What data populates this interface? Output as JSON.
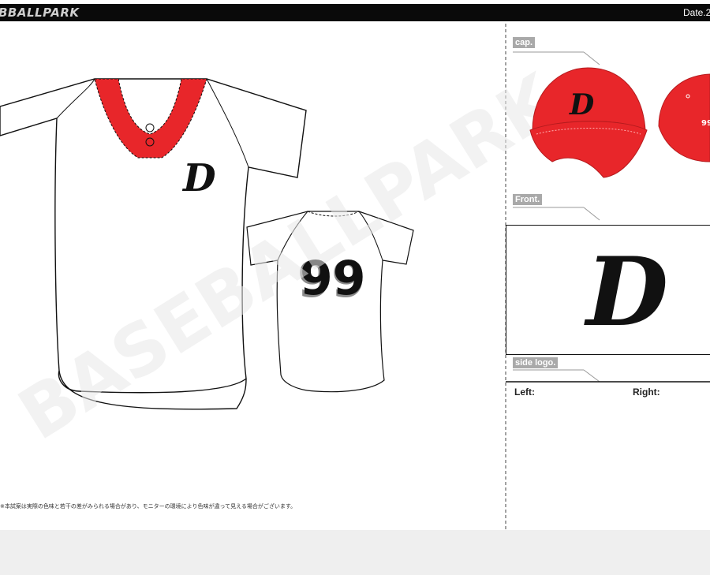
{
  "header": {
    "brand": "BBALLPARK",
    "date_label": "Date.2"
  },
  "watermark": "BASEBALLPARK",
  "jersey": {
    "front_logo": "D",
    "back_number": "99",
    "collar_color": "#e8262a",
    "body_color": "#ffffff"
  },
  "sections": {
    "cap": {
      "label": "cap.",
      "logo": "D",
      "number": "99",
      "cap_color": "#e8262a"
    },
    "front": {
      "label": "Front.",
      "logo": "D"
    },
    "side_logo": {
      "label": "side logo.",
      "left_label": "Left:",
      "right_label": "Right:"
    }
  },
  "footer": {
    "disclaimer": "※本試案は実際の色味と若干の差がみられる場合があり、モニターの環境により色味が違って見える場合がございます。"
  }
}
